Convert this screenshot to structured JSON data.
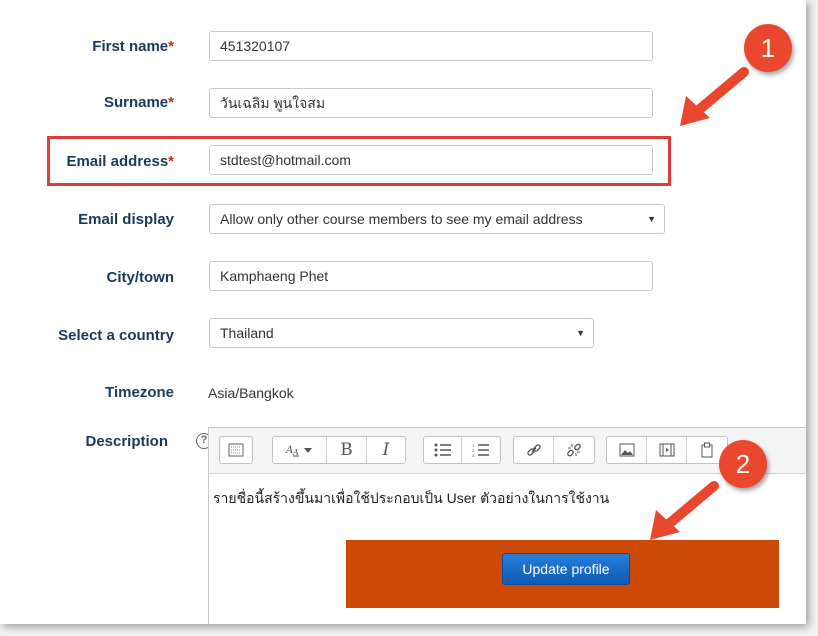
{
  "form": {
    "first_name": {
      "label": "First name",
      "required_mark": "*",
      "value": "451320107"
    },
    "surname": {
      "label": "Surname",
      "required_mark": "*",
      "value": "วันเฉลิม พูนใจสม"
    },
    "email": {
      "label": "Email address",
      "required_mark": "*",
      "value": "stdtest@hotmail.com"
    },
    "email_display": {
      "label": "Email display",
      "value": "Allow only other course members to see my email address"
    },
    "city": {
      "label": "City/town",
      "value": "Kamphaeng Phet"
    },
    "country": {
      "label": "Select a country",
      "value": "Thailand"
    },
    "timezone": {
      "label": "Timezone",
      "value": "Asia/Bangkok"
    },
    "description": {
      "label": "Description",
      "help_icon": "?",
      "text": "รายชื่อนี้สร้างขึ้นมาเพื่อใช้ประกอบเป็น User ตัวอย่างในการใช้งาน"
    }
  },
  "toolbar": {
    "icons": [
      "collapse-icon",
      "font-style-icon",
      "bold-icon",
      "italic-icon",
      "unordered-list-icon",
      "ordered-list-icon",
      "link-icon",
      "unlink-icon",
      "image-icon",
      "media-icon",
      "paste-icon"
    ],
    "bold_label": "B",
    "italic_label": "I"
  },
  "buttons": {
    "update_profile": "Update profile"
  },
  "annotations": {
    "marker_1": "1",
    "marker_2": "2"
  },
  "colors": {
    "label_text": "#1a3a5a",
    "required": "#c7290f",
    "highlight_border": "#e03b3b",
    "marker_bg": "#e9482e",
    "orange_box": "#cc4a05",
    "button_bg": "#1a6ec8"
  }
}
